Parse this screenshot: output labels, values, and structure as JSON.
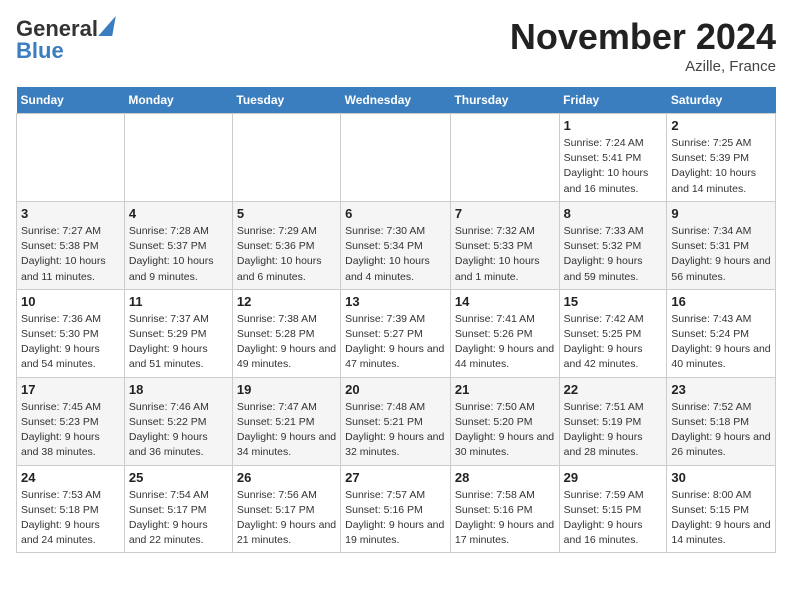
{
  "header": {
    "logo_line1": "General",
    "logo_line2": "Blue",
    "month": "November 2024",
    "location": "Azille, France"
  },
  "days_of_week": [
    "Sunday",
    "Monday",
    "Tuesday",
    "Wednesday",
    "Thursday",
    "Friday",
    "Saturday"
  ],
  "weeks": [
    [
      {
        "day": "",
        "info": ""
      },
      {
        "day": "",
        "info": ""
      },
      {
        "day": "",
        "info": ""
      },
      {
        "day": "",
        "info": ""
      },
      {
        "day": "",
        "info": ""
      },
      {
        "day": "1",
        "info": "Sunrise: 7:24 AM\nSunset: 5:41 PM\nDaylight: 10 hours and 16 minutes."
      },
      {
        "day": "2",
        "info": "Sunrise: 7:25 AM\nSunset: 5:39 PM\nDaylight: 10 hours and 14 minutes."
      }
    ],
    [
      {
        "day": "3",
        "info": "Sunrise: 7:27 AM\nSunset: 5:38 PM\nDaylight: 10 hours and 11 minutes."
      },
      {
        "day": "4",
        "info": "Sunrise: 7:28 AM\nSunset: 5:37 PM\nDaylight: 10 hours and 9 minutes."
      },
      {
        "day": "5",
        "info": "Sunrise: 7:29 AM\nSunset: 5:36 PM\nDaylight: 10 hours and 6 minutes."
      },
      {
        "day": "6",
        "info": "Sunrise: 7:30 AM\nSunset: 5:34 PM\nDaylight: 10 hours and 4 minutes."
      },
      {
        "day": "7",
        "info": "Sunrise: 7:32 AM\nSunset: 5:33 PM\nDaylight: 10 hours and 1 minute."
      },
      {
        "day": "8",
        "info": "Sunrise: 7:33 AM\nSunset: 5:32 PM\nDaylight: 9 hours and 59 minutes."
      },
      {
        "day": "9",
        "info": "Sunrise: 7:34 AM\nSunset: 5:31 PM\nDaylight: 9 hours and 56 minutes."
      }
    ],
    [
      {
        "day": "10",
        "info": "Sunrise: 7:36 AM\nSunset: 5:30 PM\nDaylight: 9 hours and 54 minutes."
      },
      {
        "day": "11",
        "info": "Sunrise: 7:37 AM\nSunset: 5:29 PM\nDaylight: 9 hours and 51 minutes."
      },
      {
        "day": "12",
        "info": "Sunrise: 7:38 AM\nSunset: 5:28 PM\nDaylight: 9 hours and 49 minutes."
      },
      {
        "day": "13",
        "info": "Sunrise: 7:39 AM\nSunset: 5:27 PM\nDaylight: 9 hours and 47 minutes."
      },
      {
        "day": "14",
        "info": "Sunrise: 7:41 AM\nSunset: 5:26 PM\nDaylight: 9 hours and 44 minutes."
      },
      {
        "day": "15",
        "info": "Sunrise: 7:42 AM\nSunset: 5:25 PM\nDaylight: 9 hours and 42 minutes."
      },
      {
        "day": "16",
        "info": "Sunrise: 7:43 AM\nSunset: 5:24 PM\nDaylight: 9 hours and 40 minutes."
      }
    ],
    [
      {
        "day": "17",
        "info": "Sunrise: 7:45 AM\nSunset: 5:23 PM\nDaylight: 9 hours and 38 minutes."
      },
      {
        "day": "18",
        "info": "Sunrise: 7:46 AM\nSunset: 5:22 PM\nDaylight: 9 hours and 36 minutes."
      },
      {
        "day": "19",
        "info": "Sunrise: 7:47 AM\nSunset: 5:21 PM\nDaylight: 9 hours and 34 minutes."
      },
      {
        "day": "20",
        "info": "Sunrise: 7:48 AM\nSunset: 5:21 PM\nDaylight: 9 hours and 32 minutes."
      },
      {
        "day": "21",
        "info": "Sunrise: 7:50 AM\nSunset: 5:20 PM\nDaylight: 9 hours and 30 minutes."
      },
      {
        "day": "22",
        "info": "Sunrise: 7:51 AM\nSunset: 5:19 PM\nDaylight: 9 hours and 28 minutes."
      },
      {
        "day": "23",
        "info": "Sunrise: 7:52 AM\nSunset: 5:18 PM\nDaylight: 9 hours and 26 minutes."
      }
    ],
    [
      {
        "day": "24",
        "info": "Sunrise: 7:53 AM\nSunset: 5:18 PM\nDaylight: 9 hours and 24 minutes."
      },
      {
        "day": "25",
        "info": "Sunrise: 7:54 AM\nSunset: 5:17 PM\nDaylight: 9 hours and 22 minutes."
      },
      {
        "day": "26",
        "info": "Sunrise: 7:56 AM\nSunset: 5:17 PM\nDaylight: 9 hours and 21 minutes."
      },
      {
        "day": "27",
        "info": "Sunrise: 7:57 AM\nSunset: 5:16 PM\nDaylight: 9 hours and 19 minutes."
      },
      {
        "day": "28",
        "info": "Sunrise: 7:58 AM\nSunset: 5:16 PM\nDaylight: 9 hours and 17 minutes."
      },
      {
        "day": "29",
        "info": "Sunrise: 7:59 AM\nSunset: 5:15 PM\nDaylight: 9 hours and 16 minutes."
      },
      {
        "day": "30",
        "info": "Sunrise: 8:00 AM\nSunset: 5:15 PM\nDaylight: 9 hours and 14 minutes."
      }
    ]
  ]
}
